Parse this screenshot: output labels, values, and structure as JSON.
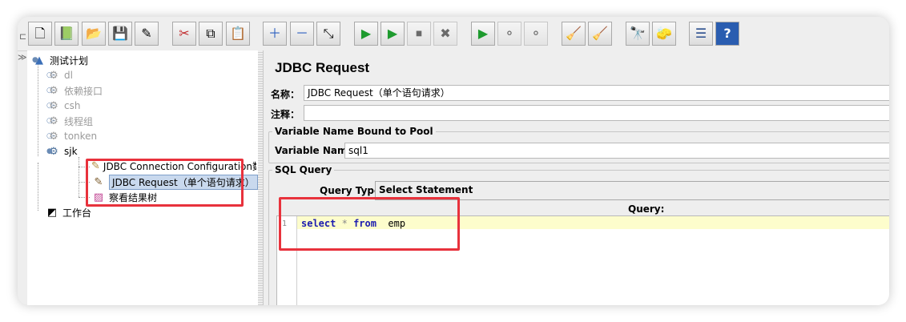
{
  "toolbar": {
    "buttons": [
      {
        "name": "new-icon",
        "glyph": "🗋"
      },
      {
        "name": "templates-icon",
        "glyph": "📗"
      },
      {
        "name": "open-icon",
        "glyph": "📂"
      },
      {
        "name": "save-icon",
        "glyph": "💾"
      },
      {
        "name": "save-as-icon",
        "glyph": "✎"
      },
      {
        "name": "cut-icon",
        "glyph": "✂"
      },
      {
        "name": "copy-icon",
        "glyph": "⧉"
      },
      {
        "name": "paste-icon",
        "glyph": "📋"
      },
      {
        "name": "expand-icon",
        "glyph": "＋"
      },
      {
        "name": "collapse-icon",
        "glyph": "－"
      },
      {
        "name": "toggle-icon",
        "glyph": "⤡"
      },
      {
        "name": "start-icon",
        "glyph": "▶"
      },
      {
        "name": "start-no-pauses-icon",
        "glyph": "▶"
      },
      {
        "name": "stop-icon",
        "glyph": "⏹"
      },
      {
        "name": "shutdown-icon",
        "glyph": "✖"
      },
      {
        "name": "remote-start-icon",
        "glyph": "▶"
      },
      {
        "name": "remote-stop-icon",
        "glyph": "⚬"
      },
      {
        "name": "remote-shutdown-icon",
        "glyph": "⚬"
      },
      {
        "name": "clear-icon",
        "glyph": "🧹"
      },
      {
        "name": "clear-all-icon",
        "glyph": "🧹"
      },
      {
        "name": "search-icon",
        "glyph": "🔭"
      },
      {
        "name": "reset-search-icon",
        "glyph": "🧽"
      },
      {
        "name": "function-helper-icon",
        "glyph": "☰"
      },
      {
        "name": "help-icon",
        "glyph": "?"
      }
    ]
  },
  "tree": {
    "root": "测试计划",
    "items": [
      "dl",
      "依赖接口",
      "csh",
      "线程组",
      "tonken",
      "sjk"
    ],
    "children": [
      "JDBC Connection Configuration数据",
      "JDBC Request（单个语句请求）",
      "察看结果树"
    ],
    "workbench": "工作台"
  },
  "panel": {
    "title": "JDBC Request",
    "name_label": "名称：",
    "name_value": "JDBC Request（单个语句请求）",
    "comment_label": "注释：",
    "comment_value": "",
    "pool_group": "Variable Name Bound to Pool",
    "variable_name_label": "Variable Name:",
    "variable_name_value": "sql1",
    "sql_group": "SQL Query",
    "query_type_label": "Query Type:",
    "query_type_value": "Select Statement",
    "query_label": "Query:",
    "line_number": "1",
    "code": {
      "kw1": "select",
      "op": "*",
      "kw2": "from",
      "table": "emp"
    }
  }
}
